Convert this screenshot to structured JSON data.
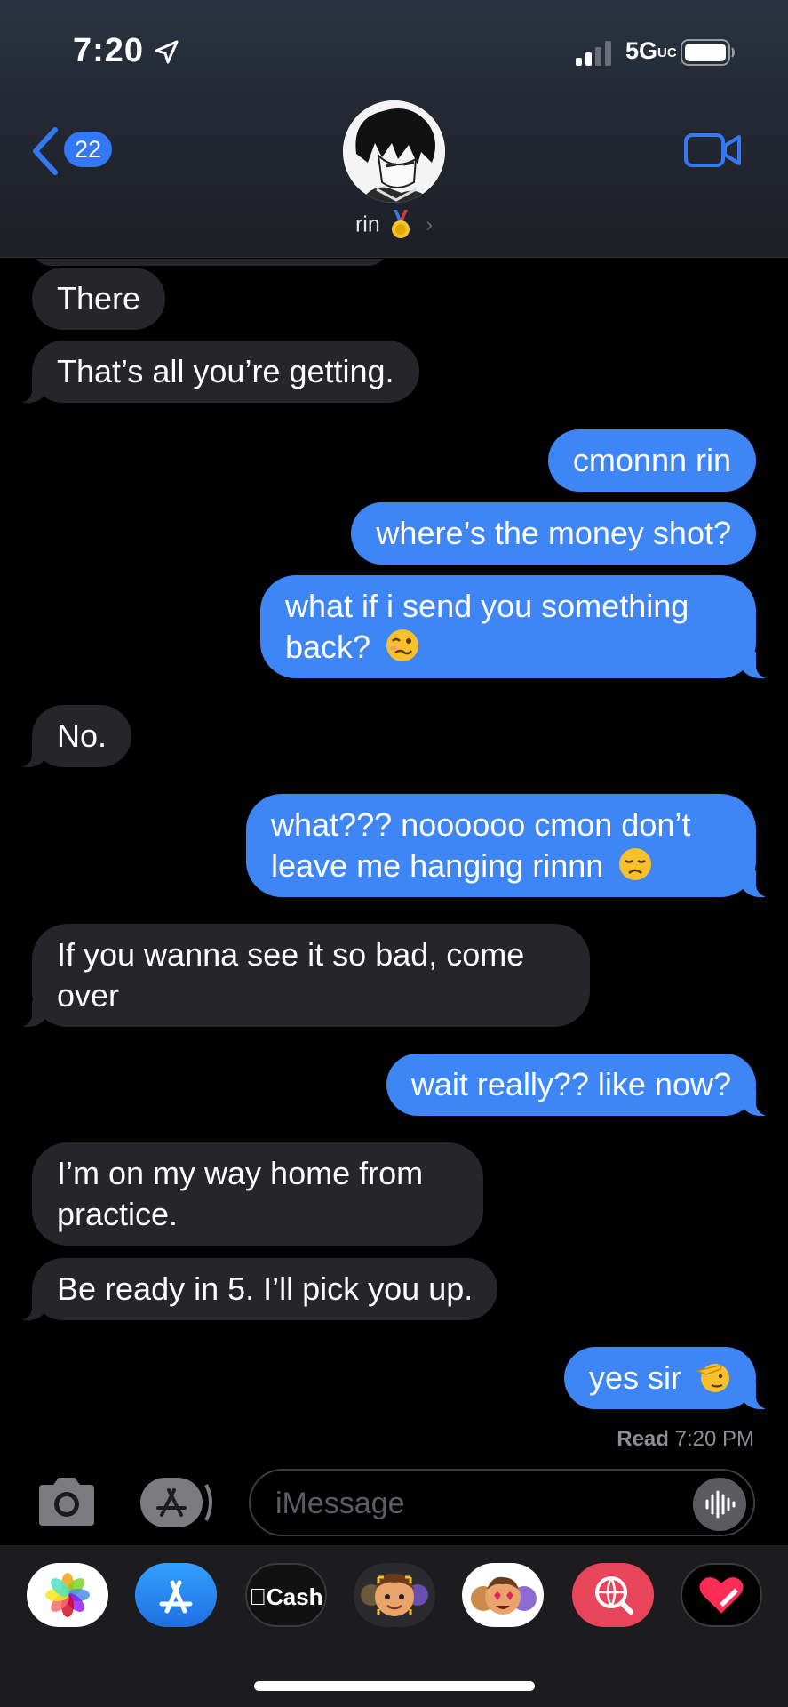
{
  "status_bar": {
    "time": "7:20",
    "network": "5G",
    "network_sub": "UC"
  },
  "header": {
    "back_count": "22",
    "contact_name": "rin"
  },
  "messages": [
    {
      "from": "them",
      "text": "There"
    },
    {
      "from": "them",
      "text": "That’s all you’re getting."
    },
    {
      "from": "me",
      "text": "cmonnn rin"
    },
    {
      "from": "me",
      "text": "where’s the money shot?"
    },
    {
      "from": "me",
      "text": "what if i send you something back?",
      "line2": "back?",
      "line1": "what if i send you something",
      "emoji": "woozy-face"
    },
    {
      "from": "them",
      "text": "No."
    },
    {
      "from": "me",
      "line1": "what??? noooooo cmon don’t",
      "line2": "leave me hanging rinnn",
      "emoji": "disappointed-face"
    },
    {
      "from": "them",
      "line1": "If you wanna see it so bad, come",
      "line2": "over"
    },
    {
      "from": "me",
      "text": "wait really?? like now?"
    },
    {
      "from": "them",
      "line1": "I’m on my way home from",
      "line2": "practice."
    },
    {
      "from": "them",
      "text": "Be ready in 5. I’ll pick you up."
    },
    {
      "from": "me",
      "text": "yes sir",
      "emoji": "saluting-face"
    }
  ],
  "read_receipt": {
    "label": "Read",
    "time": "7:20 PM"
  },
  "composer": {
    "placeholder": "iMessage"
  },
  "app_drawer": [
    {
      "name": "photos-app"
    },
    {
      "name": "app-store-app"
    },
    {
      "name": "apple-cash-app",
      "label": "Cash"
    },
    {
      "name": "memoji-app"
    },
    {
      "name": "memoji-stickers-app"
    },
    {
      "name": "images-search-app"
    },
    {
      "name": "digital-touch-app"
    }
  ],
  "colors": {
    "outgoing": "#3e86f5",
    "incoming": "#26252a",
    "accent": "#3478f6"
  }
}
